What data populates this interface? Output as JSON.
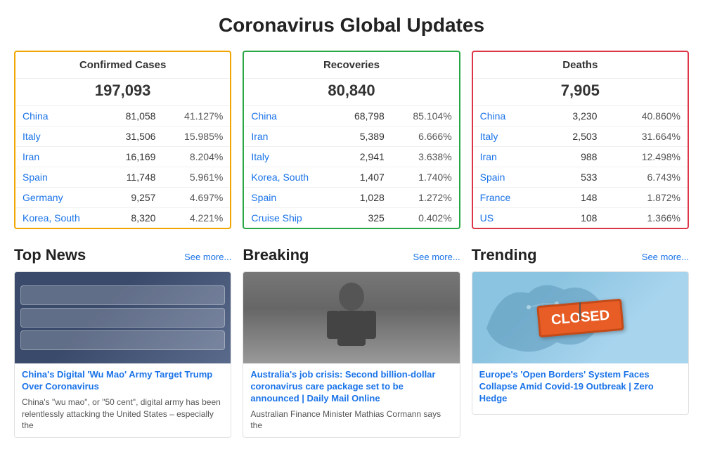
{
  "page": {
    "title": "Coronavirus Global Updates"
  },
  "confirmed": {
    "label": "Confirmed Cases",
    "total": "197,093",
    "rows": [
      {
        "country": "China",
        "count": "81,058",
        "pct": "41.127%"
      },
      {
        "country": "Italy",
        "count": "31,506",
        "pct": "15.985%"
      },
      {
        "country": "Iran",
        "count": "16,169",
        "pct": "8.204%"
      },
      {
        "country": "Spain",
        "count": "11,748",
        "pct": "5.961%"
      },
      {
        "country": "Germany",
        "count": "9,257",
        "pct": "4.697%"
      },
      {
        "country": "Korea, South",
        "count": "8,320",
        "pct": "4.221%"
      }
    ]
  },
  "recoveries": {
    "label": "Recoveries",
    "total": "80,840",
    "rows": [
      {
        "country": "China",
        "count": "68,798",
        "pct": "85.104%"
      },
      {
        "country": "Iran",
        "count": "5,389",
        "pct": "6.666%"
      },
      {
        "country": "Italy",
        "count": "2,941",
        "pct": "3.638%"
      },
      {
        "country": "Korea, South",
        "count": "1,407",
        "pct": "1.740%"
      },
      {
        "country": "Spain",
        "count": "1,028",
        "pct": "1.272%"
      },
      {
        "country": "Cruise Ship",
        "count": "325",
        "pct": "0.402%"
      }
    ]
  },
  "deaths": {
    "label": "Deaths",
    "total": "7,905",
    "rows": [
      {
        "country": "China",
        "count": "3,230",
        "pct": "40.860%"
      },
      {
        "country": "Italy",
        "count": "2,503",
        "pct": "31.664%"
      },
      {
        "country": "Iran",
        "count": "988",
        "pct": "12.498%"
      },
      {
        "country": "Spain",
        "count": "533",
        "pct": "6.743%"
      },
      {
        "country": "France",
        "count": "148",
        "pct": "1.872%"
      },
      {
        "country": "US",
        "count": "108",
        "pct": "1.366%"
      }
    ]
  },
  "news": {
    "top_news": {
      "section_title": "Top News",
      "see_more": "See more...",
      "card": {
        "title": "China's Digital 'Wu Mao' Army Target Trump Over Coronavirus",
        "text": "China's \"wu mao\", or \"50 cent\", digital army has been relentlessly attacking the United States – especially the"
      }
    },
    "breaking": {
      "section_title": "Breaking",
      "see_more": "See more...",
      "card": {
        "title": "Australia's job crisis: Second billion-dollar coronavirus care package set to be announced | Daily Mail Online",
        "text": "Australian Finance Minister Mathias Cormann says the"
      }
    },
    "trending": {
      "section_title": "Trending",
      "see_more": "See more...",
      "card": {
        "title": "Europe's 'Open Borders' System Faces Collapse Amid Covid-19 Outbreak | Zero Hedge",
        "closed_label": "CLOSED"
      }
    }
  }
}
